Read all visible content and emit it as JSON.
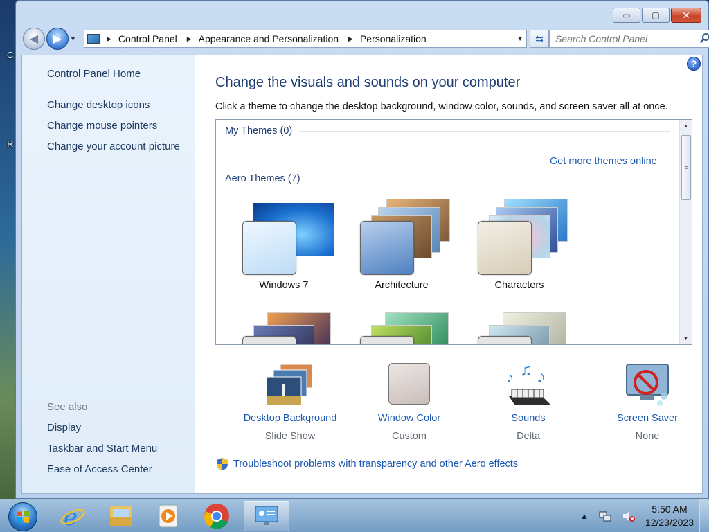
{
  "desktop": {
    "edge_letters": [
      "C",
      "R"
    ]
  },
  "window": {
    "caption": {
      "minimize": "▭",
      "maximize": "▢",
      "close": "✕"
    },
    "navbar": {
      "breadcrumbs": [
        "Control Panel",
        "Appearance and Personalization",
        "Personalization"
      ],
      "search_placeholder": "Search Control Panel"
    },
    "left_pane": {
      "home": "Control Panel Home",
      "links": [
        "Change desktop icons",
        "Change mouse pointers",
        "Change your account picture"
      ],
      "see_also_title": "See also",
      "see_also": [
        "Display",
        "Taskbar and Start Menu",
        "Ease of Access Center"
      ]
    },
    "main": {
      "title": "Change the visuals and sounds on your computer",
      "description": "Click a theme to change the desktop background, window color, sounds, and screen saver all at once.",
      "my_themes_header": "My Themes (0)",
      "get_more_link": "Get more themes online",
      "aero_themes_header": "Aero Themes (7)",
      "themes": [
        {
          "name": "Windows 7",
          "swatch": "#cfe6fb"
        },
        {
          "name": "Architecture",
          "swatch": "#7ea6d6"
        },
        {
          "name": "Characters",
          "swatch": "#e9e2d2"
        }
      ],
      "tiles": [
        {
          "link": "Desktop Background",
          "value": "Slide Show",
          "icon": "desktop-background-icon"
        },
        {
          "link": "Window Color",
          "value": "Custom",
          "icon": "window-color-icon"
        },
        {
          "link": "Sounds",
          "value": "Delta",
          "icon": "sounds-icon"
        },
        {
          "link": "Screen Saver",
          "value": "None",
          "icon": "screen-saver-icon"
        }
      ],
      "troubleshoot": "Troubleshoot problems with transparency and other Aero effects"
    }
  },
  "taskbar": {
    "apps": [
      "internet-explorer",
      "file-explorer",
      "media-player",
      "chrome",
      "control-panel"
    ],
    "clock_time": "5:50 AM",
    "clock_date": "12/23/2023",
    "tray_arrow": "▲"
  },
  "colors": {
    "link": "#1a58b0",
    "title": "#1e3d73",
    "window_chrome": "#c9dcf2"
  }
}
